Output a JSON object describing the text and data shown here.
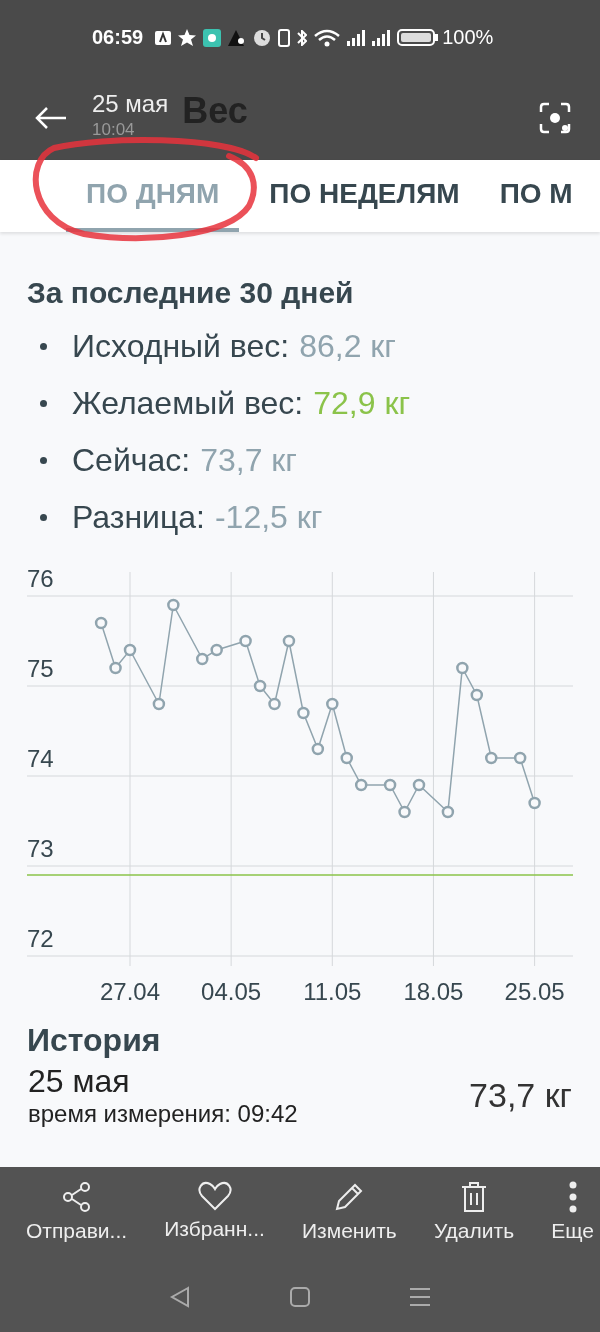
{
  "status_bar": {
    "time": "06:59",
    "battery": "100%"
  },
  "header": {
    "title": "Вес",
    "overlay_date": "25 мая",
    "overlay_time": "10:04"
  },
  "tabs": [
    {
      "label": "ПО ДНЯМ",
      "selected": true
    },
    {
      "label": "ПО НЕДЕЛЯМ",
      "selected": false
    },
    {
      "label": "ПО М",
      "selected": false
    }
  ],
  "summary": {
    "title": "За последние 30 дней",
    "items": [
      {
        "label": "Исходный вес:",
        "value": "86,2 кг",
        "color": "#90a4ae"
      },
      {
        "label": "Желаемый вес:",
        "value": "72,9 кг",
        "color": "#8bc34a"
      },
      {
        "label": "Сейчас:",
        "value": "73,7 кг",
        "color": "#90a4ae"
      },
      {
        "label": "Разница:",
        "value": "-12,5 кг",
        "color": "#90a4ae"
      }
    ]
  },
  "chart": {
    "chart_data": {
      "type": "line",
      "categories": [
        null,
        null,
        "27.04",
        null,
        null,
        null,
        null,
        null,
        null,
        "04.05",
        null,
        null,
        null,
        null,
        null,
        null,
        "11.05",
        null,
        null,
        null,
        null,
        null,
        null,
        "18.05",
        null,
        null,
        null,
        null,
        null,
        null,
        "25.05"
      ],
      "series": [
        {
          "color": "#90a4ae",
          "marker": "circle",
          "values": [
            75.7,
            75.2,
            75.4,
            null,
            74.8,
            75.9,
            null,
            75.3,
            75.4,
            null,
            75.5,
            75.0,
            74.8,
            75.5,
            74.7,
            74.3,
            74.8,
            74.2,
            73.9,
            null,
            73.9,
            73.6,
            73.9,
            null,
            73.6,
            75.2,
            74.9,
            74.2,
            null,
            74.2,
            73.7
          ]
        }
      ],
      "ylim": [
        72,
        76
      ],
      "grid": true,
      "yticks": [
        72,
        73,
        74,
        75,
        76
      ],
      "ref_lines": [
        {
          "axis": "y",
          "value": 72.9,
          "color": "#8bc34a"
        }
      ]
    }
  },
  "history": {
    "title": "История",
    "entry": {
      "date": "25 мая",
      "subtitle": "время измерения: 09:42",
      "value": "73,7 кг"
    }
  },
  "actions": [
    {
      "kind": "share",
      "label": "Отправи..."
    },
    {
      "kind": "favorite",
      "label": "Избранн..."
    },
    {
      "kind": "edit",
      "label": "Изменить"
    },
    {
      "kind": "delete",
      "label": "Удалить"
    },
    {
      "kind": "more",
      "label": "Еще"
    }
  ]
}
